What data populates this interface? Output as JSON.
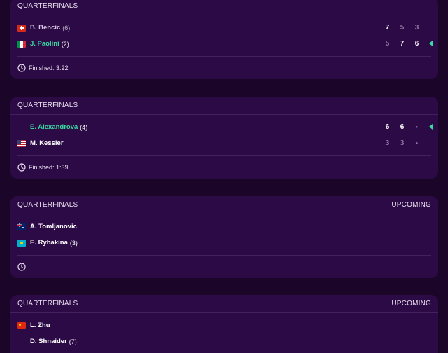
{
  "matches": [
    {
      "round": "QUARTERFINALS",
      "status": "",
      "footer": "Finished: 3:22",
      "players": [
        {
          "flag": "switzerland-flag-icon",
          "name": "B. Bencic",
          "seed": "(6)",
          "scores": [
            "7",
            "5",
            "3"
          ],
          "winner": false
        },
        {
          "flag": "italy-flag-icon",
          "name": "J. Paolini",
          "seed": "(2)",
          "scores": [
            "5",
            "7",
            "6"
          ],
          "winner": true
        }
      ]
    },
    {
      "round": "QUARTERFINALS",
      "status": "",
      "footer": "Finished: 1:39",
      "players": [
        {
          "flag": "",
          "name": "E. Alexandrova",
          "seed": "(4)",
          "scores": [
            "6",
            "6",
            "•"
          ],
          "winner": true
        },
        {
          "flag": "usa-flag-icon",
          "name": "M. Kessler",
          "seed": "",
          "scores": [
            "3",
            "3",
            "•"
          ],
          "winner": false
        }
      ]
    },
    {
      "round": "QUARTERFINALS",
      "status": "UPCOMING",
      "footer": "",
      "players": [
        {
          "flag": "australia-flag-icon",
          "name": "A. Tomljanovic",
          "seed": "",
          "scores": [],
          "winner": false
        },
        {
          "flag": "kazakhstan-flag-icon",
          "name": "E. Rybakina",
          "seed": "(3)",
          "scores": [],
          "winner": false
        }
      ]
    },
    {
      "round": "QUARTERFINALS",
      "status": "UPCOMING",
      "footer": "",
      "players": [
        {
          "flag": "china-flag-icon",
          "name": "L. Zhu",
          "seed": "",
          "scores": [],
          "winner": false
        },
        {
          "flag": "",
          "name": "D. Shnaider",
          "seed": "(7)",
          "scores": [],
          "winner": false
        }
      ]
    }
  ],
  "colors": {
    "background": "#1b0629",
    "card": "#2c0a45",
    "winner_accent": "#39d9a0",
    "loser_score": "#8f7aa3"
  }
}
